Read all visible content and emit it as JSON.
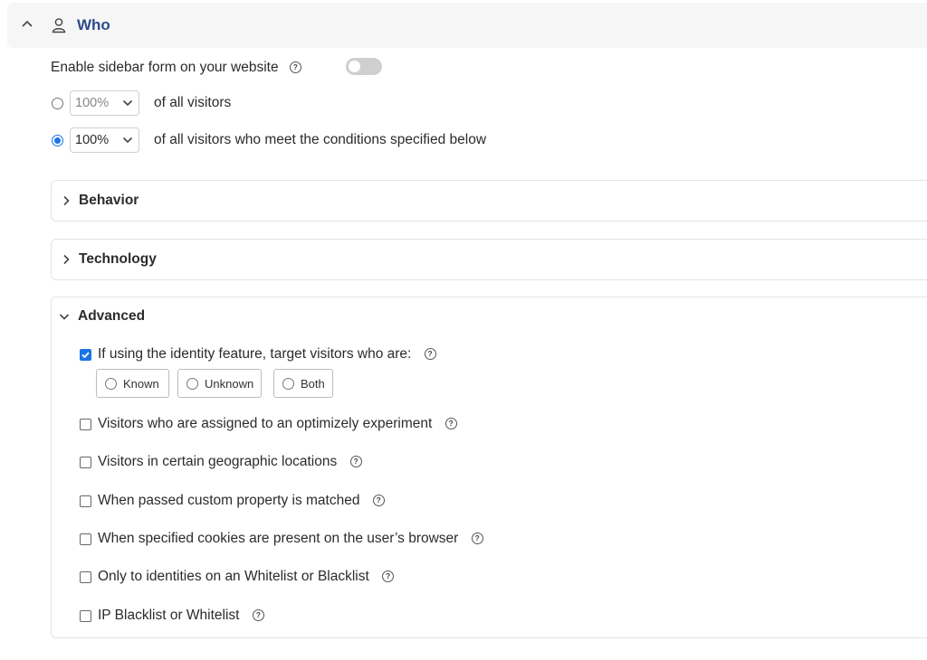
{
  "who": {
    "title": "Who"
  },
  "enable": {
    "label": "Enable sidebar form on your website",
    "toggle_on": false
  },
  "targeting": {
    "all": {
      "percent": "100%",
      "label": "of all visitors",
      "selected": false
    },
    "conditional": {
      "percent": "100%",
      "label": "of all visitors who meet the conditions specified below",
      "selected": true
    }
  },
  "sections": {
    "behavior": {
      "title": "Behavior",
      "expanded": false
    },
    "technology": {
      "title": "Technology",
      "expanded": false
    },
    "advanced": {
      "title": "Advanced",
      "expanded": true
    }
  },
  "advanced": {
    "identity": {
      "label": "If using the identity feature, target visitors who are:",
      "checked": true,
      "options": [
        "Known",
        "Unknown",
        "Both"
      ]
    },
    "items": [
      {
        "label": "Visitors who are assigned to an optimizely experiment",
        "checked": false
      },
      {
        "label": "Visitors in certain geographic locations",
        "checked": false
      },
      {
        "label": "When passed custom property is matched",
        "checked": false
      },
      {
        "label": "When specified cookies are present on the user’s browser",
        "checked": false
      },
      {
        "label": "Only to identities on an Whitelist or Blacklist",
        "checked": false
      },
      {
        "label": "IP Blacklist or Whitelist",
        "checked": false
      }
    ]
  },
  "icons": {
    "help": "?",
    "accent_color": "#1a73e8",
    "title_color": "#2f4a8a"
  }
}
